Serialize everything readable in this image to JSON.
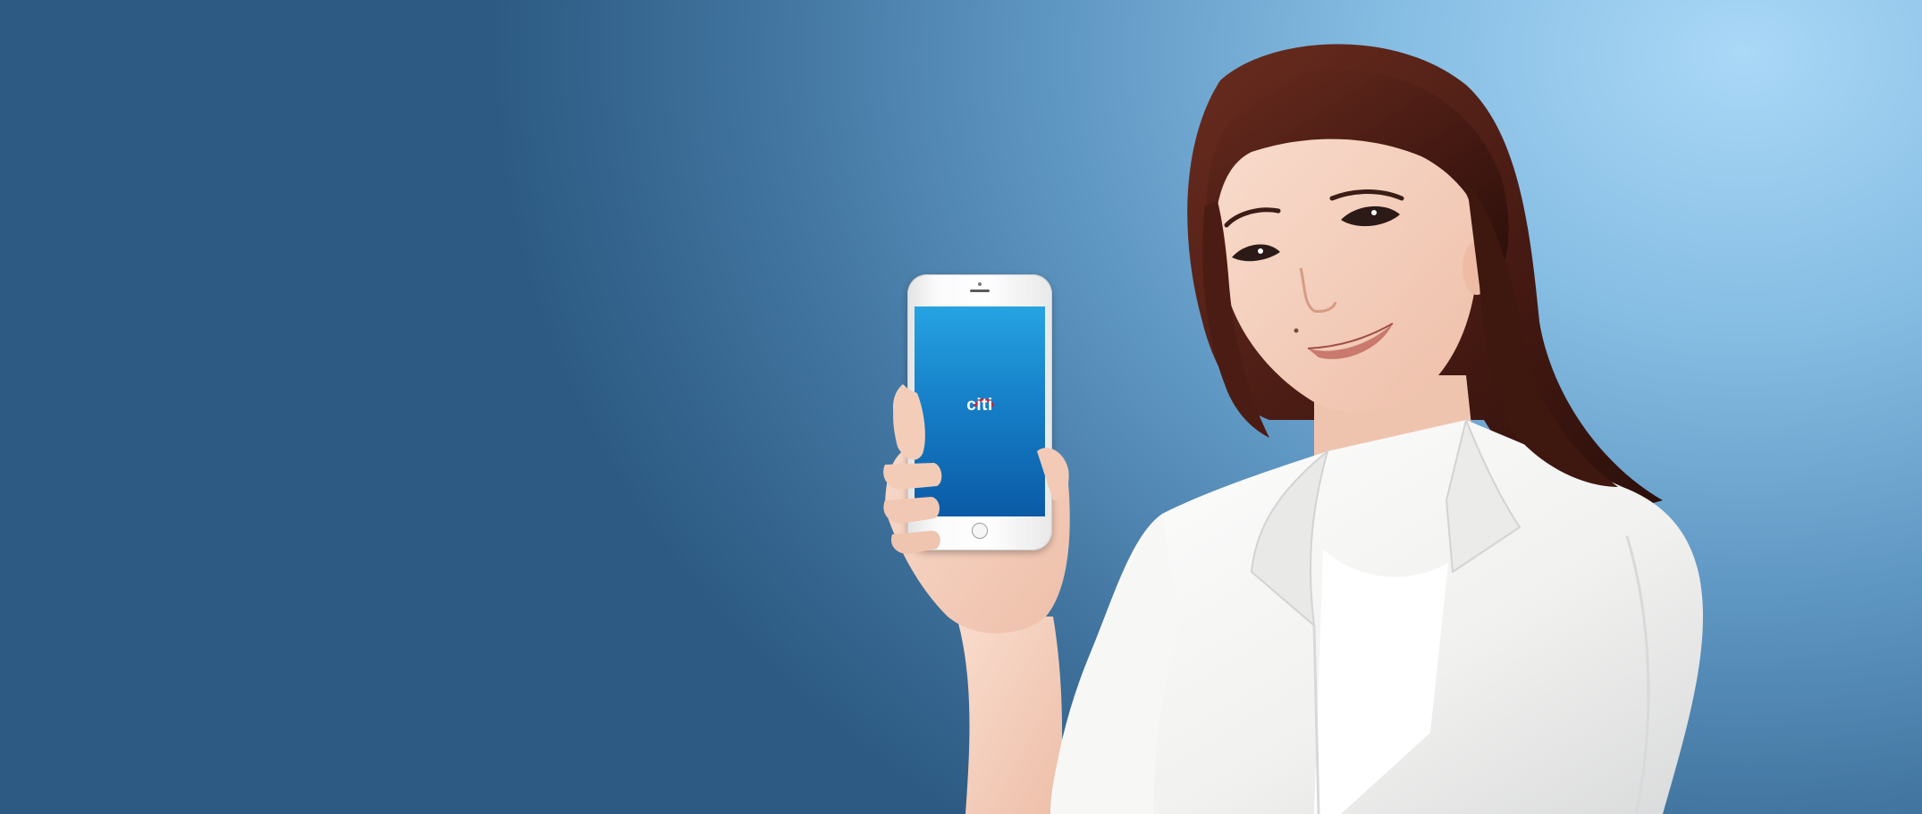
{
  "phone": {
    "app_logo_text": "citi",
    "screen_color_top": "#26a3e2",
    "screen_color_bottom": "#0b5aa6"
  },
  "background": {
    "color_light": "#aad8f7",
    "color_dark": "#2c5a82"
  },
  "person": {
    "blazer_color": "#f4f4f2",
    "hair_color": "#4a1f16"
  }
}
